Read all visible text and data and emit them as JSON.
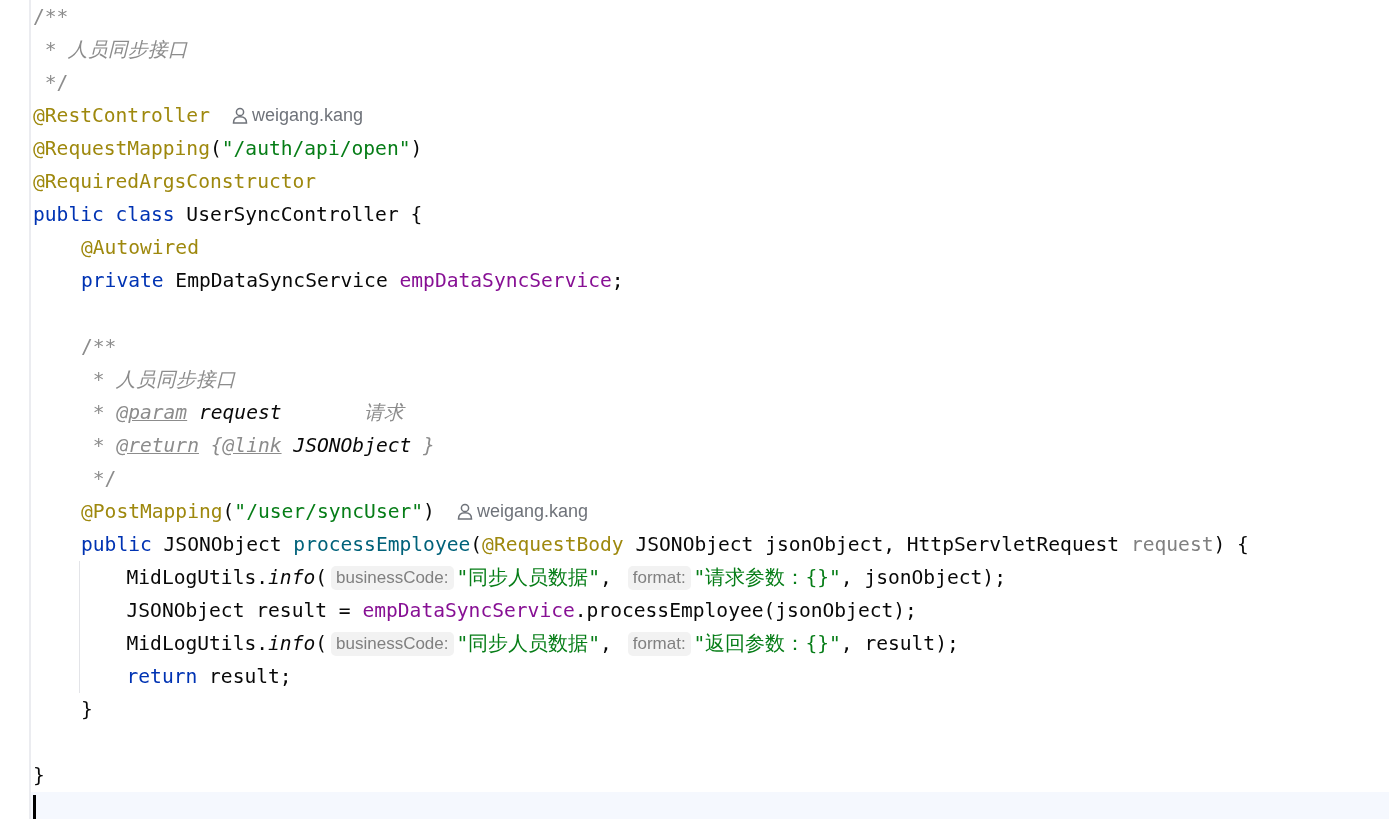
{
  "editor": {
    "lines": [
      {
        "kind": "code",
        "tokens": [
          {
            "text": "/**",
            "kind": "comment"
          }
        ]
      },
      {
        "kind": "code",
        "tokens": [
          {
            "text": " * ",
            "kind": "comment"
          },
          {
            "text": "人员同步接口",
            "kind": "doc-text"
          }
        ]
      },
      {
        "kind": "code",
        "tokens": [
          {
            "text": " */",
            "kind": "comment"
          }
        ]
      },
      {
        "kind": "code",
        "tokens": [
          {
            "text": "@RestController",
            "kind": "annotation"
          },
          {
            "text": "weigang.kang",
            "kind": "author"
          }
        ]
      },
      {
        "kind": "code",
        "tokens": [
          {
            "text": "@RequestMapping",
            "kind": "annotation"
          },
          {
            "text": "(",
            "kind": "plain"
          },
          {
            "text": "\"/auth/api/open\"",
            "kind": "string"
          },
          {
            "text": ")",
            "kind": "plain"
          }
        ]
      },
      {
        "kind": "code",
        "tokens": [
          {
            "text": "@RequiredArgsConstructor",
            "kind": "annotation"
          }
        ]
      },
      {
        "kind": "code",
        "tokens": [
          {
            "text": "public class",
            "kind": "keyword"
          },
          {
            "text": " UserSyncController {",
            "kind": "plain"
          }
        ],
        "children": [
          {
            "kind": "code",
            "tokens": [
              {
                "text": "@Autowired",
                "kind": "annotation"
              }
            ]
          },
          {
            "kind": "code",
            "tokens": [
              {
                "text": "private",
                "kind": "keyword"
              },
              {
                "text": " EmpDataSyncService ",
                "kind": "plain"
              },
              {
                "text": "empDataSyncService",
                "kind": "field"
              },
              {
                "text": ";",
                "kind": "plain"
              }
            ]
          },
          {
            "kind": "blank"
          },
          {
            "kind": "code",
            "tokens": [
              {
                "text": "/**",
                "kind": "comment"
              }
            ]
          },
          {
            "kind": "code",
            "tokens": [
              {
                "text": " * ",
                "kind": "comment"
              },
              {
                "text": "人员同步接口",
                "kind": "doc-text"
              }
            ]
          },
          {
            "kind": "code",
            "tokens": [
              {
                "text": " * ",
                "kind": "comment"
              },
              {
                "text": "@param",
                "kind": "doc-tag"
              },
              {
                "text": " request",
                "kind": "doc-ref"
              },
              {
                "text": "       请求",
                "kind": "doc-text"
              }
            ]
          },
          {
            "kind": "code",
            "tokens": [
              {
                "text": " * ",
                "kind": "comment"
              },
              {
                "text": "@return",
                "kind": "doc-tag"
              },
              {
                "text": " {",
                "kind": "doc-text"
              },
              {
                "text": "@link",
                "kind": "doc-tag"
              },
              {
                "text": " JSONObject",
                "kind": "doc-ref"
              },
              {
                "text": " }",
                "kind": "doc-text"
              }
            ]
          },
          {
            "kind": "code",
            "tokens": [
              {
                "text": " */",
                "kind": "comment"
              }
            ]
          },
          {
            "kind": "code",
            "tokens": [
              {
                "text": "@PostMapping",
                "kind": "annotation"
              },
              {
                "text": "(",
                "kind": "plain"
              },
              {
                "text": "\"/user/syncUser\"",
                "kind": "string"
              },
              {
                "text": ")",
                "kind": "plain"
              },
              {
                "text": "weigang.kang",
                "kind": "author"
              }
            ]
          },
          {
            "kind": "code",
            "tokens": [
              {
                "text": "public",
                "kind": "keyword"
              },
              {
                "text": " JSONObject ",
                "kind": "plain"
              },
              {
                "text": "processEmployee",
                "kind": "method"
              },
              {
                "text": "(",
                "kind": "plain"
              },
              {
                "text": "@RequestBody",
                "kind": "annotation"
              },
              {
                "text": " JSONObject jsonObject, HttpServletRequest ",
                "kind": "plain"
              },
              {
                "text": "request",
                "kind": "unused"
              },
              {
                "text": ") {",
                "kind": "plain"
              }
            ],
            "children": [
              {
                "kind": "code",
                "tokens": [
                  {
                    "text": "MidLogUtils.",
                    "kind": "plain"
                  },
                  {
                    "text": "info",
                    "kind": "static"
                  },
                  {
                    "text": "(",
                    "kind": "plain"
                  },
                  {
                    "text": "businessCode:",
                    "kind": "hint"
                  },
                  {
                    "text": "\"同步人员数据\"",
                    "kind": "string"
                  },
                  {
                    "text": ", ",
                    "kind": "plain"
                  },
                  {
                    "text": "format:",
                    "kind": "hint"
                  },
                  {
                    "text": "\"请求参数：{}\"",
                    "kind": "string"
                  },
                  {
                    "text": ", jsonObject);",
                    "kind": "plain"
                  }
                ]
              },
              {
                "kind": "code",
                "tokens": [
                  {
                    "text": "JSONObject result = ",
                    "kind": "plain"
                  },
                  {
                    "text": "empDataSyncService",
                    "kind": "field"
                  },
                  {
                    "text": ".processEmployee(jsonObject);",
                    "kind": "plain"
                  }
                ]
              },
              {
                "kind": "code",
                "tokens": [
                  {
                    "text": "MidLogUtils.",
                    "kind": "plain"
                  },
                  {
                    "text": "info",
                    "kind": "static"
                  },
                  {
                    "text": "(",
                    "kind": "plain"
                  },
                  {
                    "text": "businessCode:",
                    "kind": "hint"
                  },
                  {
                    "text": "\"同步人员数据\"",
                    "kind": "string"
                  },
                  {
                    "text": ", ",
                    "kind": "plain"
                  },
                  {
                    "text": "format:",
                    "kind": "hint"
                  },
                  {
                    "text": "\"返回参数：{}\"",
                    "kind": "string"
                  },
                  {
                    "text": ", result);",
                    "kind": "plain"
                  }
                ]
              },
              {
                "kind": "code",
                "tokens": [
                  {
                    "text": "return",
                    "kind": "keyword"
                  },
                  {
                    "text": " result;",
                    "kind": "plain"
                  }
                ]
              }
            ]
          },
          {
            "kind": "code",
            "tokens": [
              {
                "text": "}",
                "kind": "plain"
              }
            ]
          }
        ]
      },
      {
        "kind": "blank"
      },
      {
        "kind": "code",
        "tokens": [
          {
            "text": "}",
            "kind": "plain"
          }
        ]
      }
    ],
    "caret_line": {
      "current": true
    }
  }
}
